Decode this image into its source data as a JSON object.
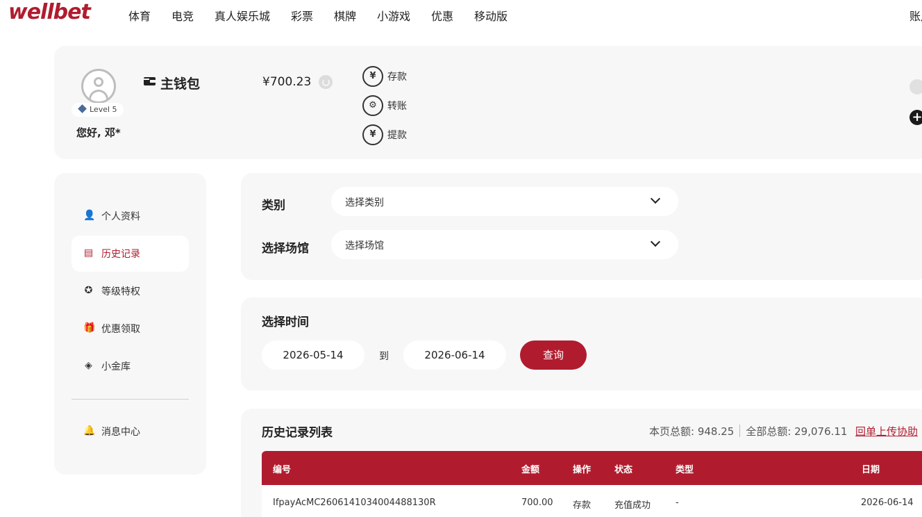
{
  "nav": {
    "logo": "wellbet",
    "items": [
      "体育",
      "电竞",
      "真人娱乐城",
      "彩票",
      "棋牌",
      "小游戏",
      "优惠",
      "移动版"
    ],
    "account_label": "账户"
  },
  "profile": {
    "level": "Level 5",
    "greeting": "您好, 邓*"
  },
  "wallet": {
    "title": "主钱包",
    "balance": "¥700.23",
    "actions": [
      "存款",
      "转账",
      "提款"
    ],
    "action_glyphs": [
      "¥",
      "⚙",
      "¥"
    ]
  },
  "sidebar": {
    "items": [
      {
        "label": "个人资料",
        "icon": "user-icon",
        "glyph": "👤"
      },
      {
        "label": "历史记录",
        "icon": "document-icon",
        "glyph": "▤"
      },
      {
        "label": "等级特权",
        "icon": "medal-icon",
        "glyph": "✪"
      },
      {
        "label": "优惠领取",
        "icon": "gift-icon",
        "glyph": "🎁"
      },
      {
        "label": "小金库",
        "icon": "diamond-icon",
        "glyph": "◈"
      },
      {
        "label": "消息中心",
        "icon": "bell-icon",
        "glyph": "🔔"
      }
    ]
  },
  "filters": {
    "category_label": "类别",
    "category_value": "选择类别",
    "venue_label": "选择场馆",
    "venue_value": "选择场馆"
  },
  "time": {
    "title": "选择时间",
    "start_date": "2026-05-14",
    "to_label": "到",
    "end_date": "2026-06-14",
    "query_button": "查询"
  },
  "history": {
    "title": "历史记录列表",
    "page_total": "本页总额: 948.25",
    "all_total": "全部总额: 29,076.11",
    "upload_link": "回单上传协助",
    "columns": [
      "编号",
      "金额",
      "操作",
      "状态",
      "类型",
      "日期"
    ],
    "rows": [
      {
        "id": "IfpayAcMC260614103400448813​0R",
        "amount": "700.00",
        "action": "存款",
        "status": "充值成功",
        "type": "-",
        "date": "2026-06-14"
      }
    ]
  },
  "colors": {
    "brand": "#b01c2e",
    "card_bg": "#f7f7f8"
  }
}
